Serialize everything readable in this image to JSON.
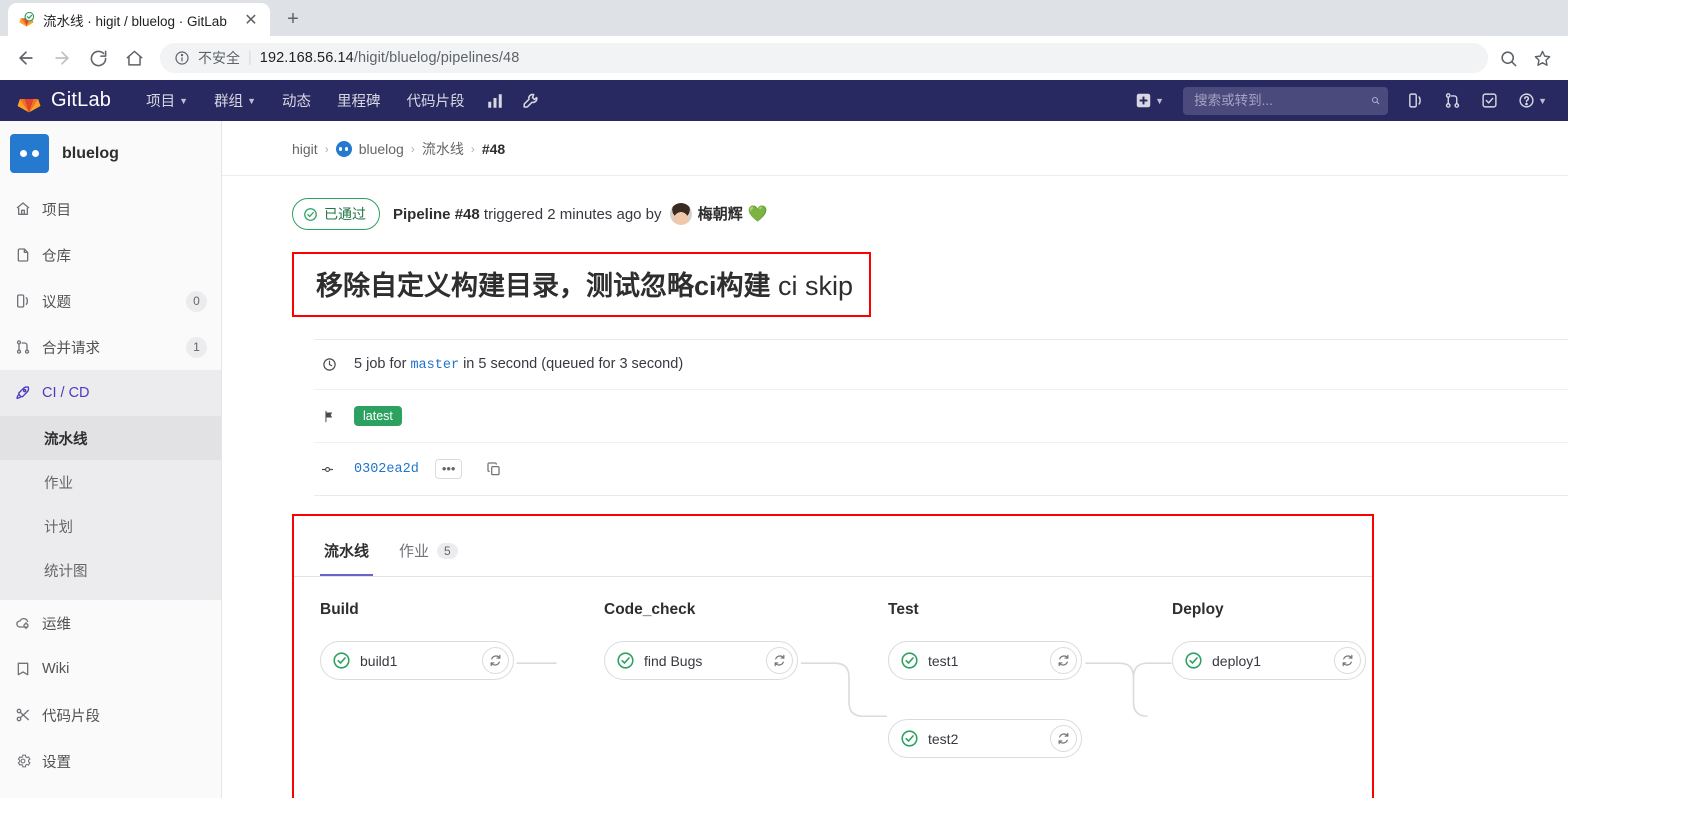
{
  "browser": {
    "tab_title": "流水线 · higit / bluelog · GitLab",
    "close_label": "✕",
    "newtab_label": "+",
    "security_label": "不安全",
    "url_host": "192.168.56.14",
    "url_path": "/higit/bluelog/pipelines/48"
  },
  "gitlab_nav": {
    "brand": "GitLab",
    "items": [
      {
        "label": "项目",
        "has_caret": true
      },
      {
        "label": "群组",
        "has_caret": true
      },
      {
        "label": "动态",
        "has_caret": false
      },
      {
        "label": "里程碑",
        "has_caret": false
      },
      {
        "label": "代码片段",
        "has_caret": false
      }
    ],
    "search_placeholder": "搜索或转到..."
  },
  "sidebar": {
    "project_name": "bluelog",
    "items": [
      {
        "label": "项目",
        "icon": "home-icon",
        "badge": ""
      },
      {
        "label": "仓库",
        "icon": "file-icon",
        "badge": ""
      },
      {
        "label": "议题",
        "icon": "issues-icon",
        "badge": "0"
      },
      {
        "label": "合并请求",
        "icon": "merge-request-icon",
        "badge": "1"
      },
      {
        "label": "CI / CD",
        "icon": "rocket-icon",
        "badge": ""
      }
    ],
    "ci_subitems": [
      {
        "label": "流水线",
        "active": true
      },
      {
        "label": "作业",
        "active": false
      },
      {
        "label": "计划",
        "active": false
      },
      {
        "label": "统计图",
        "active": false
      }
    ],
    "items_after": [
      {
        "label": "运维",
        "icon": "cloud-gear-icon"
      },
      {
        "label": "Wiki",
        "icon": "book-icon"
      },
      {
        "label": "代码片段",
        "icon": "scissors-icon"
      },
      {
        "label": "设置",
        "icon": "gear-icon"
      }
    ]
  },
  "breadcrumb": {
    "group": "higit",
    "project": "bluelog",
    "section": "流水线",
    "current": "#48"
  },
  "pipeline": {
    "status_text": "已通过",
    "status_color": "#2da160",
    "desc_prefix": "Pipeline",
    "desc_id": "#48",
    "desc_mid": "triggered 2 minutes ago by",
    "user_name": "梅朝辉",
    "heart": "💚",
    "title": "移除自定义构建目录，测试忽略ci构建",
    "title_suffix": "ci skip",
    "jobs_summary_prefix": "5 job for",
    "jobs_summary_branch": "master",
    "jobs_summary_suffix": "in 5 second (queued for 3 second)",
    "tag_label": "latest",
    "commit_sha": "0302ea2d",
    "ellipsis_label": "•••"
  },
  "graph": {
    "tabs": [
      {
        "label": "流水线",
        "count": "",
        "active": true
      },
      {
        "label": "作业",
        "count": "5",
        "active": false
      }
    ],
    "stages": [
      {
        "name": "Build",
        "jobs": [
          {
            "name": "build1",
            "status": "success",
            "action": "retry-icon"
          }
        ]
      },
      {
        "name": "Code_check",
        "jobs": [
          {
            "name": "find Bugs",
            "status": "success",
            "action": "retry-icon"
          }
        ]
      },
      {
        "name": "Test",
        "jobs": [
          {
            "name": "test1",
            "status": "success",
            "action": "retry-icon"
          },
          {
            "name": "test2",
            "status": "success",
            "action": "retry-icon"
          }
        ]
      },
      {
        "name": "Deploy",
        "jobs": [
          {
            "name": "deploy1",
            "status": "success",
            "action": "retry-icon"
          }
        ]
      }
    ]
  }
}
